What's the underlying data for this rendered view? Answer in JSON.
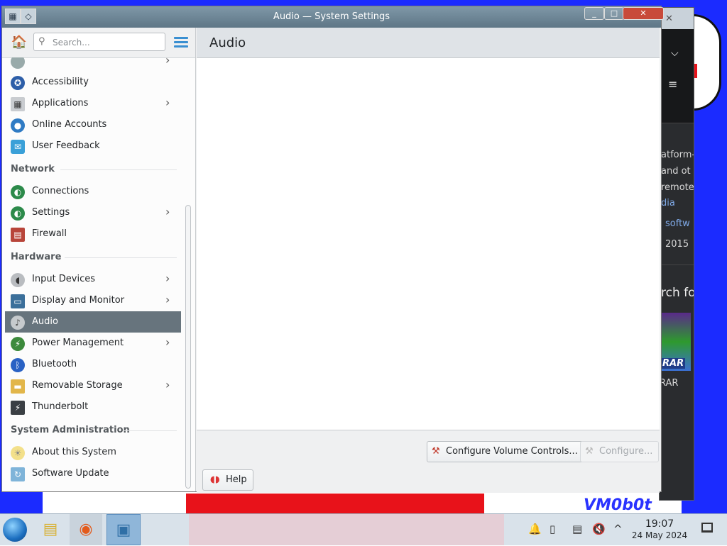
{
  "window": {
    "title": "Audio — System Settings",
    "close_label": "✕",
    "max_label": "□",
    "min_label": "_"
  },
  "sidebar": {
    "search_placeholder": "Search...",
    "items_top": [
      {
        "label": "Accessibility",
        "icon": "accessibility-icon",
        "has_arrow": false
      },
      {
        "label": "Applications",
        "icon": "applications-icon",
        "has_arrow": true
      },
      {
        "label": "Online Accounts",
        "icon": "online-accounts-icon",
        "has_arrow": false
      },
      {
        "label": "User Feedback",
        "icon": "user-feedback-icon",
        "has_arrow": false
      }
    ],
    "categories": {
      "network": "Network",
      "hardware": "Hardware",
      "sysadmin": "System Administration"
    },
    "network_items": [
      {
        "label": "Connections",
        "icon": "globe-icon",
        "has_arrow": false
      },
      {
        "label": "Settings",
        "icon": "globe-icon",
        "has_arrow": true
      },
      {
        "label": "Firewall",
        "icon": "firewall-icon",
        "has_arrow": false
      }
    ],
    "hardware_items": [
      {
        "label": "Input Devices",
        "icon": "mouse-icon",
        "has_arrow": true
      },
      {
        "label": "Display and Monitor",
        "icon": "monitor-icon",
        "has_arrow": true
      },
      {
        "label": "Audio",
        "icon": "speaker-icon",
        "has_arrow": false,
        "active": true
      },
      {
        "label": "Power Management",
        "icon": "power-icon",
        "has_arrow": true
      },
      {
        "label": "Bluetooth",
        "icon": "bluetooth-icon",
        "has_arrow": false
      },
      {
        "label": "Removable Storage",
        "icon": "folder-icon",
        "has_arrow": true
      },
      {
        "label": "Thunderbolt",
        "icon": "thunderbolt-icon",
        "has_arrow": false
      }
    ],
    "sysadmin_items": [
      {
        "label": "About this System",
        "icon": "lightbulb-icon",
        "has_arrow": false
      },
      {
        "label": "Software Update",
        "icon": "software-update-icon",
        "has_arrow": false
      }
    ]
  },
  "content": {
    "title": "Audio",
    "configure_volume_label": "Configure Volume Controls...",
    "configure_label": "Configure...",
    "help_label": "Help"
  },
  "background_window": {
    "fragments": [
      "atform-",
      "and ot",
      "remote",
      "dia",
      "softw",
      "2015",
      "rch fo",
      "RAR"
    ],
    "rar_label": "RAR"
  },
  "taskbar": {
    "time": "19:07",
    "date": "24 May 2024"
  },
  "wallpaper": {
    "text": "VM0b0t"
  },
  "colors": {
    "active_item": "#67747d",
    "titlebar": "#6b8494",
    "accent": "#3a8fd1"
  }
}
